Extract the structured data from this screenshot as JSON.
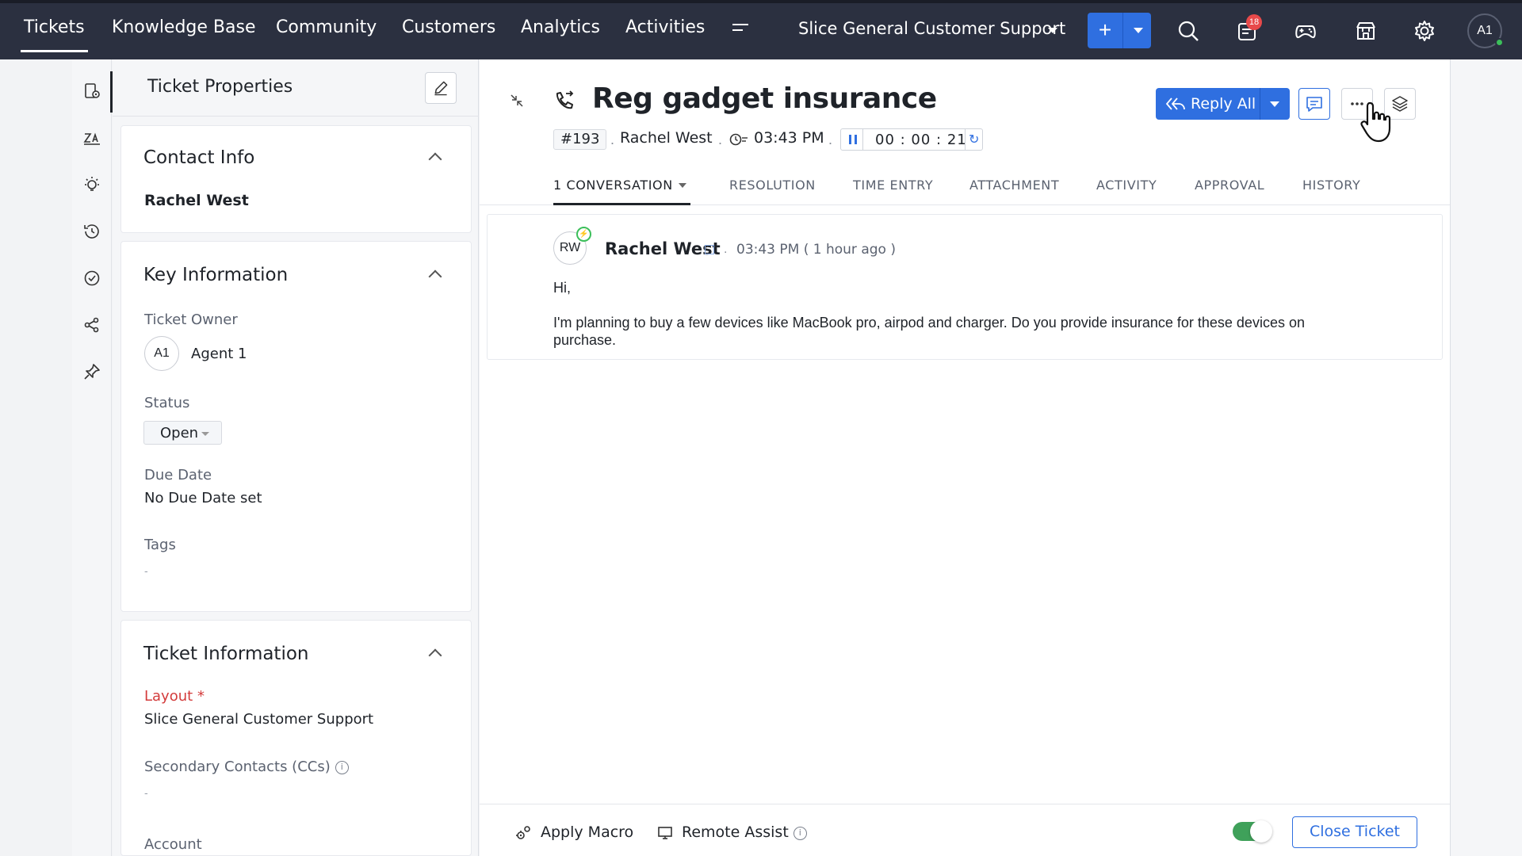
{
  "nav": {
    "tabs": [
      "Tickets",
      "Knowledge Base",
      "Community",
      "Customers",
      "Analytics",
      "Activities"
    ],
    "active_tab": "Tickets",
    "department": "Slice General Customer Support",
    "add_label": "+",
    "notification_count": "18",
    "user_initials": "A1",
    "icons": [
      "search-icon",
      "notifications-icon",
      "gamepad-icon",
      "marketplace-icon",
      "settings-icon"
    ]
  },
  "rail": {
    "icons": [
      "ticket-properties-icon",
      "sentiment-icon",
      "ideas-icon",
      "history-icon",
      "approval-icon",
      "share-icon",
      "pin-icon"
    ]
  },
  "props": {
    "title": "Ticket Properties",
    "contact": {
      "title": "Contact Info",
      "name": "Rachel West"
    },
    "key_info": {
      "title": "Key Information",
      "owner_label": "Ticket Owner",
      "owner_initials": "A1",
      "owner_name": "Agent 1",
      "status_label": "Status",
      "status_value": "Open",
      "due_label": "Due Date",
      "due_value": "No Due Date set",
      "tags_label": "Tags",
      "tags_value": "-"
    },
    "ticket_info": {
      "title": "Ticket Information",
      "layout_label": "Layout",
      "required_mark": "*",
      "layout_value": "Slice General Customer Support",
      "cc_label": "Secondary Contacts (CCs)",
      "cc_value": "-",
      "account_label": "Account"
    }
  },
  "ticket": {
    "subject": "Reg gadget insurance",
    "number": "#193",
    "contact": "Rachel West",
    "time": "03:43 PM",
    "timer": "00 : 00 : 21",
    "reply_all": "Reply All",
    "tabs": [
      "1 CONVERSATION",
      "RESOLUTION",
      "TIME ENTRY",
      "ATTACHMENT",
      "ACTIVITY",
      "APPROVAL",
      "HISTORY"
    ],
    "active_tab": "1 CONVERSATION"
  },
  "thread": {
    "avatar": "RW",
    "author": "Rachel West",
    "timestamp": "03:43 PM ( 1 hour ago )",
    "greeting": "Hi,",
    "body_line1": "I'm planning to buy a few devices like MacBook pro, airpod and charger. Do you provide insurance for these devices on",
    "body_line2": "purchase."
  },
  "footer": {
    "apply_macro": "Apply Macro",
    "remote_assist": "Remote Assist",
    "close_ticket": "Close Ticket"
  },
  "colors": {
    "topbar": "#2b3040",
    "accent": "#2f6fe0",
    "toggle_on": "#3fa15a",
    "badge": "#e8494a"
  }
}
